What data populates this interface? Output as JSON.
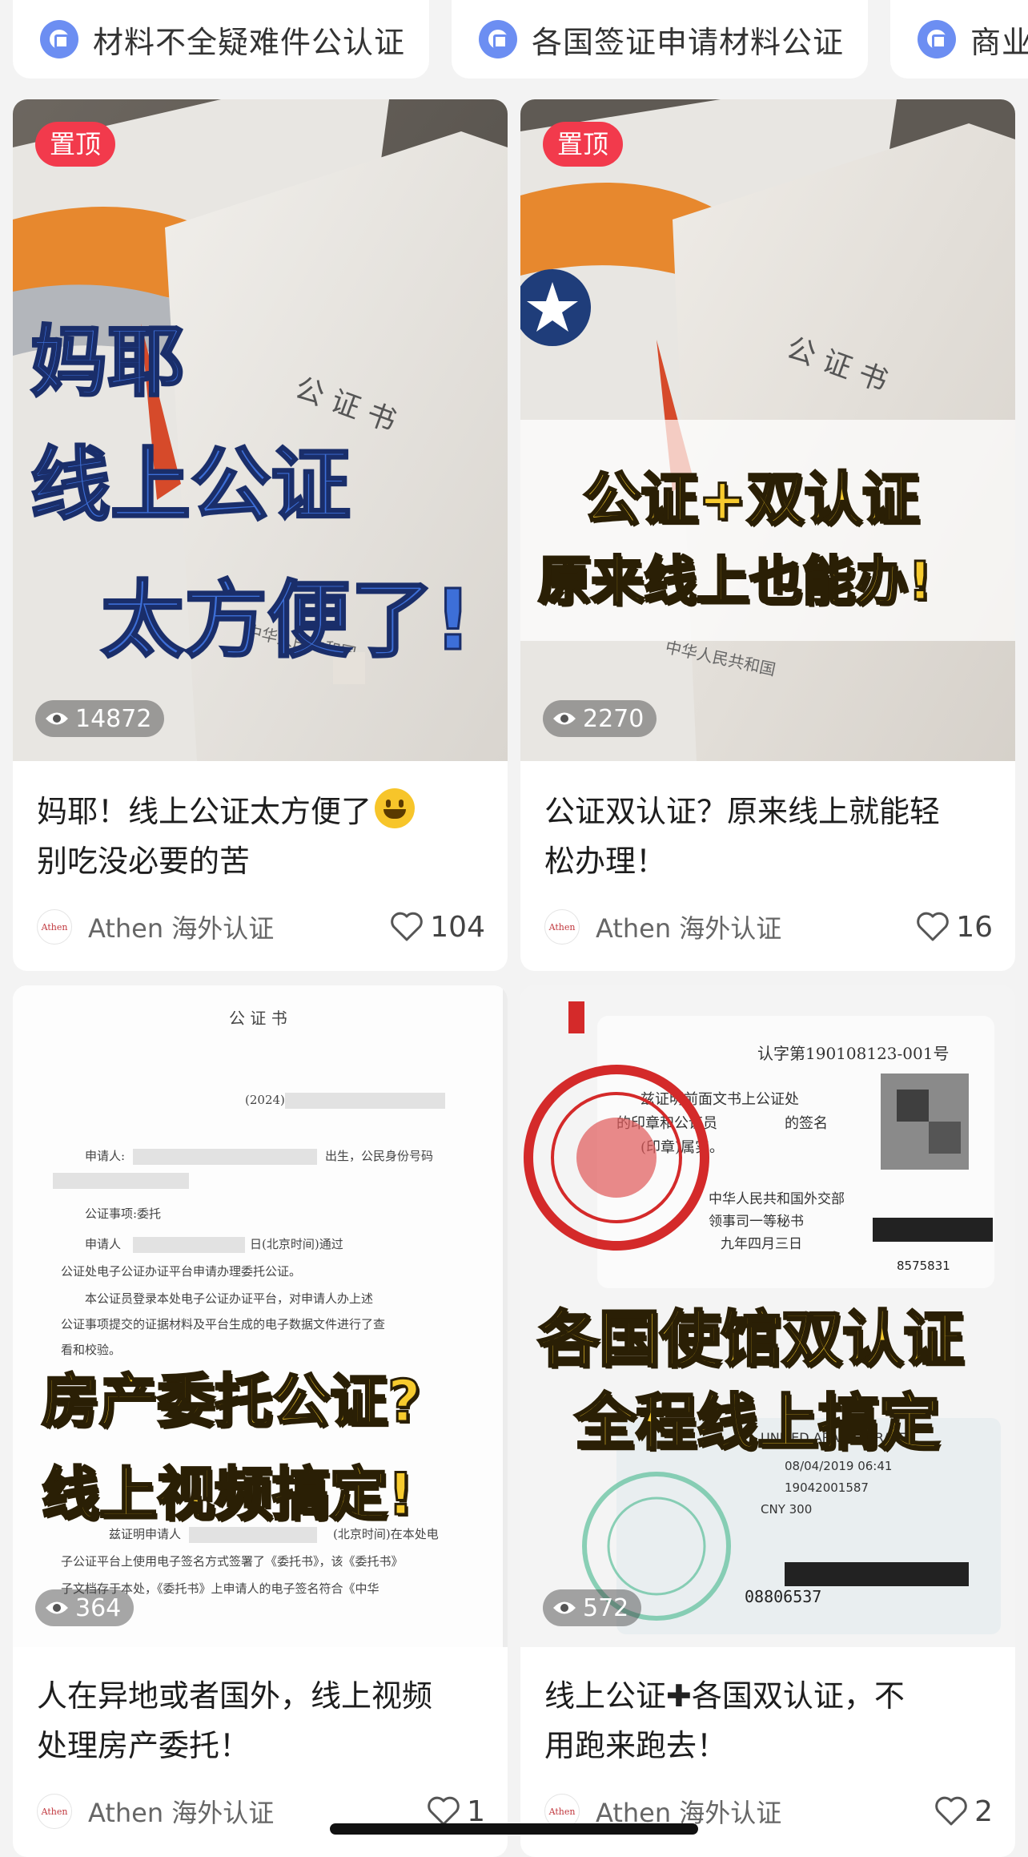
{
  "tags": [
    {
      "label": "材料不全疑难件公认证",
      "icon": "tag-icon"
    },
    {
      "label": "各国签证申请材料公证",
      "icon": "tag-icon"
    },
    {
      "label": "商业文",
      "icon": "tag-icon"
    }
  ],
  "cards": [
    {
      "pinned": "置顶",
      "overlay": [
        "妈耶",
        "线上公证",
        "太方便了!"
      ],
      "doc_text": [
        "公  证  书",
        "中华人民共和国"
      ],
      "views": "14872",
      "title": "妈耶！线上公证太方便了",
      "title_line2": "别吃没必要的苦",
      "emoji": "grinning-face",
      "author": "Athen 海外认证",
      "avatar": "Athen",
      "likes": "104"
    },
    {
      "pinned": "置顶",
      "overlay": [
        "公证+双认证",
        "原来线上也能办!"
      ],
      "doc_text": [
        "公  证  书",
        "中华人民共和国"
      ],
      "views": "2270",
      "title": "公证双认证？原来线上就能轻",
      "title_line2": "松办理！",
      "author": "Athen 海外认证",
      "avatar": "Athen",
      "likes": "16"
    },
    {
      "overlay": [
        "房产委托公证?",
        "线上视频搞定!"
      ],
      "doc_text": [
        "公  证  书",
        "(2024)",
        "申请人:",
        "出生，公民身份号码",
        "公证事项:委托",
        "申请人",
        "日(北京时间)通过",
        "公证处电子公证办证平台申请办理委托公证。",
        "本公证员登录本处电子公证办证平台，对申请人办上述",
        "公证事项提交的证据材料及平台生成的电子数据文件进行了查",
        "看和校验。",
        "兹证明申请人",
        "(北京时间)在本处电",
        "子公证平台上使用电子签名方式签署了《委托书》，该《委托书》",
        "子文档存于本处，《委托书》上申请人的电子签名符合《中华"
      ],
      "views": "364",
      "title": "人在异地或者国外，线上视频",
      "title_line2": "处理房产委托！",
      "author": "Athen 海外认证",
      "avatar": "Athen",
      "likes": "1"
    },
    {
      "overlay": [
        "各国使馆双认证",
        "全程线上搞定"
      ],
      "doc_text": [
        "认字第190108123-001号",
        "兹证明前面文书上公证处",
        "的印章和公证员",
        "的签名",
        "(印章)属实。",
        "中华人民共和国外交部",
        "领事司一等秘书",
        "九年四月三日",
        "8575831",
        "UNITED ARAB EMIRATES",
        "08/04/2019 06:41",
        "19042001587",
        "CNY 300",
        "08806537"
      ],
      "views": "572",
      "title": "线上公证",
      "title_plus": "✚",
      "title_rest": "各国双认证，不",
      "title_line2": "用跑来跑去！",
      "author": "Athen 海外认证",
      "avatar": "Athen",
      "likes": "2"
    }
  ],
  "colors": {
    "pin_badge": "#f23a4c",
    "tag_icon": "#6c8ef2",
    "overlay_blue": "#3d6fd8",
    "overlay_yellow": "#f7cb2e"
  }
}
